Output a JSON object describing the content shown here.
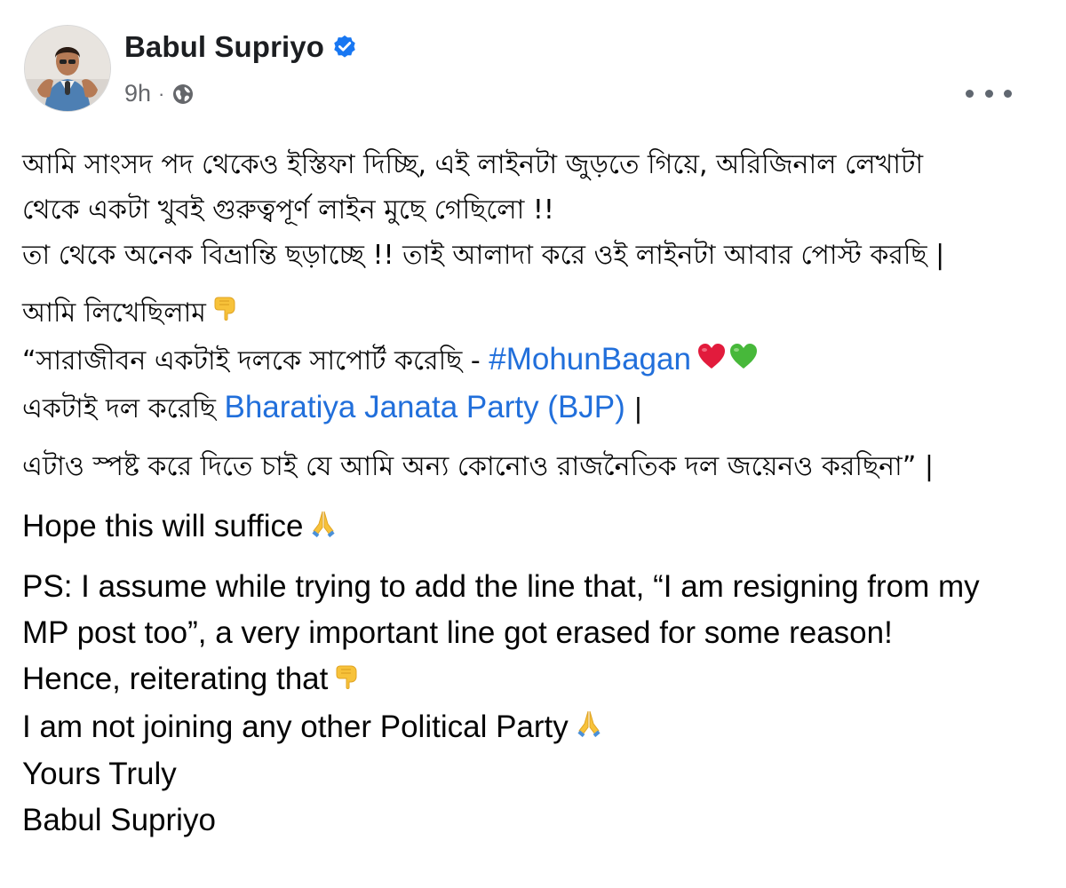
{
  "post": {
    "author": "Babul Supriyo",
    "time": "9h",
    "separator": "·",
    "colors": {
      "verified": "#1877f2",
      "link": "#216fdb",
      "meta": "#65676b"
    }
  },
  "content": {
    "bn_para1": [
      "আমি সাংসদ পদ থেকেও ইস্তিফা দিচ্ছি, এই লাইনটা জুড়তে গিয়ে, অরিজিনাল লেখাটা",
      "থেকে একটা খুবই গুরুত্বপূর্ণ লাইন মুছে গেছিলো !!",
      "তা থেকে অনেক বিভ্রান্তি ছড়াচ্ছে !! তাই আলাদা করে ওই লাইনটা আবার পোস্ট করছি |"
    ],
    "bn_wrote": "আমি লিখেছিলাম",
    "bn_quote1": "“সারাজীবন একটাই দলকে সাপোর্ট করেছি - ",
    "hashtag": "#MohunBagan",
    "bn_quote2": "একটাই দল করেছি ",
    "party_link": "Bharatiya Janata Party (BJP)",
    "bn_quote2_end": " |",
    "bn_clarify": "এটাও স্পষ্ট করে দিতে চাই যে আমি অন্য কোনোও রাজনৈতিক দল জয়েনও করছিনা” |",
    "en_hope": "Hope this will suffice",
    "en_ps": [
      "PS: I assume while trying to add the line that, “I am resigning from my",
      "MP post too”, a very important line got erased for some reason!"
    ],
    "en_hence": "Hence, reiterating that",
    "en_not_joining": "I am not joining any other Political Party",
    "en_yours": "Yours Truly",
    "en_sign": "Babul Supriyo"
  },
  "icons": {
    "pointing_down": "backhand-index-pointing-down-icon",
    "heart_red": "red-heart-icon",
    "heart_green": "green-heart-icon",
    "folded_hands": "folded-hands-icon",
    "globe": "globe-icon",
    "verified": "verified-badge-icon",
    "more": "more-options-icon"
  }
}
